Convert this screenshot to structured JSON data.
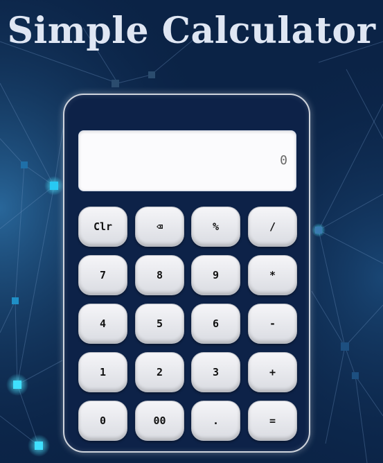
{
  "app": {
    "title": "Simple Calculator"
  },
  "display": {
    "value": "0"
  },
  "keys": [
    {
      "label": "Clr",
      "name": "clear-button"
    },
    {
      "label": "⌫",
      "name": "backspace-button"
    },
    {
      "label": "%",
      "name": "percent-button"
    },
    {
      "label": "/",
      "name": "divide-button"
    },
    {
      "label": "7",
      "name": "digit-7-button"
    },
    {
      "label": "8",
      "name": "digit-8-button"
    },
    {
      "label": "9",
      "name": "digit-9-button"
    },
    {
      "label": "*",
      "name": "multiply-button"
    },
    {
      "label": "4",
      "name": "digit-4-button"
    },
    {
      "label": "5",
      "name": "digit-5-button"
    },
    {
      "label": "6",
      "name": "digit-6-button"
    },
    {
      "label": "-",
      "name": "subtract-button"
    },
    {
      "label": "1",
      "name": "digit-1-button"
    },
    {
      "label": "2",
      "name": "digit-2-button"
    },
    {
      "label": "3",
      "name": "digit-3-button"
    },
    {
      "label": "+",
      "name": "add-button"
    },
    {
      "label": "0",
      "name": "digit-0-button"
    },
    {
      "label": "00",
      "name": "double-zero-button"
    },
    {
      "label": ".",
      "name": "decimal-button"
    },
    {
      "label": "=",
      "name": "equals-button"
    }
  ],
  "colors": {
    "background": "#0b2346",
    "calculator_body": "#0d2248",
    "display": "#fbfbfd",
    "key": "#e6e7eb",
    "network_glow": "#19c7f0"
  }
}
